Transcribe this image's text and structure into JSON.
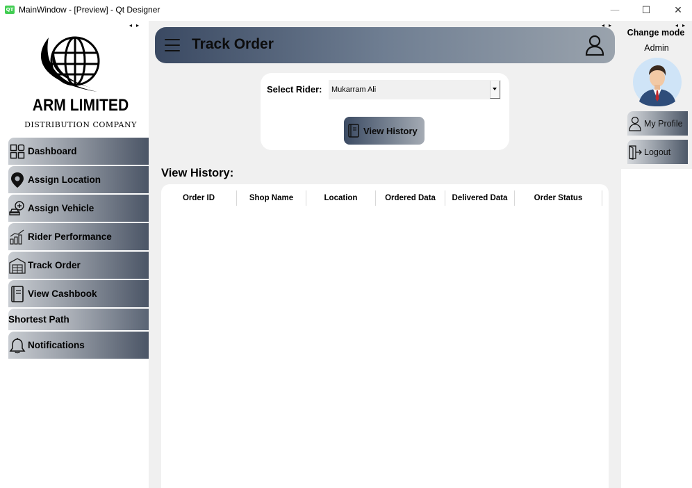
{
  "window": {
    "title": "MainWindow - [Preview] - Qt Designer",
    "app_icon": "qt-icon",
    "app_icon_text": "QT",
    "min_symbol": "—",
    "max_symbol": "☐",
    "close_symbol": "✕"
  },
  "brand": {
    "name": "ARM LIMITED",
    "subtitle": "DISTRIBUTION COMPANY"
  },
  "sidebar": {
    "items": [
      {
        "label": "Dashboard",
        "icon": "dashboard-grid-icon"
      },
      {
        "label": "Assign Location",
        "icon": "location-pin-icon"
      },
      {
        "label": "Assign Vehicle",
        "icon": "vehicle-add-icon"
      },
      {
        "label": "Rider Performance",
        "icon": "performance-chart-icon"
      },
      {
        "label": "Track Order",
        "icon": "warehouse-icon"
      },
      {
        "label": "View Cashbook",
        "icon": "cashbook-icon"
      },
      {
        "label": "Shortest Path",
        "icon": ""
      },
      {
        "label": "Notifications",
        "icon": "bell-icon"
      }
    ]
  },
  "header": {
    "title": "Track Order",
    "menu_icon": "hamburger-icon",
    "user_icon": "user-icon"
  },
  "rider": {
    "label": "Select Rider:",
    "selected": "Mukarram Ali",
    "button_label": "View History",
    "button_icon": "book-icon"
  },
  "history": {
    "title": "View History:",
    "columns": [
      "Order ID",
      "Shop Name",
      "Location",
      "Ordered Data",
      "Delivered Data",
      "Order Status"
    ],
    "rows": []
  },
  "right_panel": {
    "change_mode": "Change mode",
    "role": "Admin",
    "avatar_icon": "businessman-avatar-icon",
    "profile_label": "My Profile",
    "logout_label": "Logout"
  },
  "colors": {
    "header_start": "#3a4962",
    "header_end": "#9aa3ad",
    "panel_bg": "#f0f0f0"
  }
}
